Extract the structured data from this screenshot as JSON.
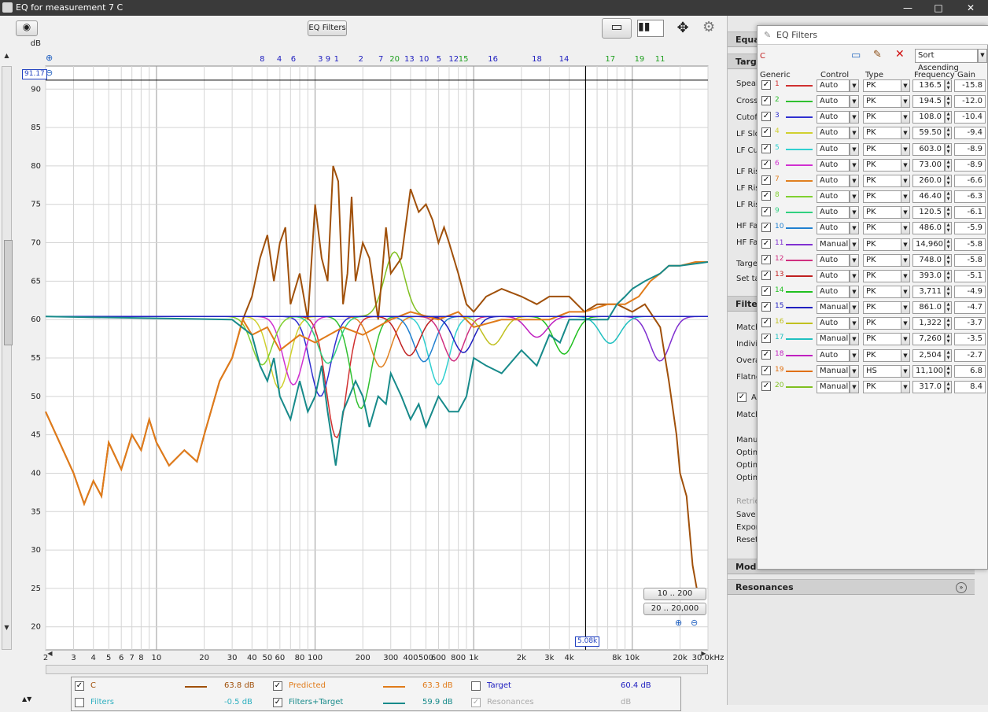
{
  "window": {
    "title": "EQ for measurement 7 C"
  },
  "toolbar": {
    "eq_filters_button": "EQ Filters"
  },
  "cursor": {
    "level": "91.17",
    "frequency": "5.08k"
  },
  "range_buttons": [
    "10 .. 200",
    "20 .. 20,000"
  ],
  "chart_data": {
    "type": "line",
    "ylabel": "dB",
    "ylim": [
      17,
      93
    ],
    "xlim": [
      2,
      30000
    ],
    "x_scale": "log",
    "y_ticks": [
      "90",
      "85",
      "80",
      "75",
      "70",
      "65",
      "60",
      "55",
      "50",
      "45",
      "40",
      "35",
      "30",
      "25",
      "20"
    ],
    "x_ticks": [
      {
        "v": 2,
        "l": "2"
      },
      {
        "v": 3,
        "l": "3"
      },
      {
        "v": 4,
        "l": "4"
      },
      {
        "v": 5,
        "l": "5"
      },
      {
        "v": 6,
        "l": "6"
      },
      {
        "v": 7,
        "l": "7"
      },
      {
        "v": 8,
        "l": "8"
      },
      {
        "v": 10,
        "l": "10"
      },
      {
        "v": 20,
        "l": "20"
      },
      {
        "v": 30,
        "l": "30"
      },
      {
        "v": 40,
        "l": "40"
      },
      {
        "v": 50,
        "l": "50"
      },
      {
        "v": 60,
        "l": "60"
      },
      {
        "v": 80,
        "l": "80"
      },
      {
        "v": 100,
        "l": "100"
      },
      {
        "v": 200,
        "l": "200"
      },
      {
        "v": 300,
        "l": "300"
      },
      {
        "v": 400,
        "l": "400"
      },
      {
        "v": 500,
        "l": "500"
      },
      {
        "v": 600,
        "l": "600"
      },
      {
        "v": 800,
        "l": "800"
      },
      {
        "v": 1000,
        "l": "1k"
      },
      {
        "v": 2000,
        "l": "2k"
      },
      {
        "v": 3000,
        "l": "3k"
      },
      {
        "v": 4000,
        "l": "4k"
      },
      {
        "v": 8000,
        "l": "8k"
      },
      {
        "v": 10000,
        "l": "10k"
      },
      {
        "v": 20000,
        "l": "20k"
      },
      {
        "v": 30000,
        "l": "30.0kHz"
      }
    ],
    "target_level": 60.4,
    "series": [
      {
        "name": "C",
        "color": "#a0500a",
        "x": [
          2,
          3,
          3.5,
          4,
          4.5,
          5,
          6,
          7,
          8,
          9,
          10,
          12,
          15,
          18,
          20,
          25,
          30,
          35,
          40,
          45,
          50,
          55,
          60,
          65,
          70,
          80,
          90,
          100,
          110,
          120,
          130,
          140,
          150,
          160,
          170,
          180,
          200,
          220,
          250,
          280,
          300,
          350,
          400,
          450,
          500,
          550,
          600,
          650,
          700,
          800,
          900,
          1000,
          1200,
          1500,
          2000,
          2500,
          3000,
          4000,
          5000,
          6000,
          8000,
          10000,
          12000,
          15000,
          17000,
          19000,
          20000,
          22000,
          24000,
          26000
        ],
        "y": [
          48,
          40,
          36,
          39,
          37,
          44,
          40.5,
          45,
          43,
          47,
          44,
          41,
          43,
          41.5,
          45,
          52,
          55,
          60,
          63,
          68,
          71,
          65,
          70,
          72,
          62,
          66,
          60,
          75,
          68,
          65,
          80,
          78,
          62,
          66,
          76,
          65,
          70,
          68,
          60,
          72,
          66,
          68,
          77,
          74,
          75,
          73,
          70,
          72,
          70,
          66,
          62,
          61,
          63,
          64,
          63,
          62,
          63,
          63,
          61,
          62,
          62,
          61,
          62,
          59,
          52,
          45,
          40,
          37,
          28,
          24
        ]
      },
      {
        "name": "Predicted",
        "color": "#e07b1a",
        "x": [
          2,
          3,
          3.5,
          4,
          4.5,
          5,
          6,
          7,
          8,
          9,
          10,
          12,
          15,
          18,
          20,
          25,
          30,
          35,
          40,
          50,
          60,
          80,
          100,
          150,
          200,
          300,
          400,
          600,
          800,
          1000,
          1500,
          2000,
          3000,
          4000,
          5000,
          7000,
          9000,
          11000,
          13000,
          15000,
          17000,
          20000,
          25000,
          30000
        ],
        "y": [
          48,
          40,
          36,
          39,
          37,
          44,
          40.5,
          45,
          43,
          47,
          44,
          41,
          43,
          41.5,
          45,
          52,
          55,
          60,
          58,
          59,
          56,
          58,
          57,
          59,
          58,
          60,
          61,
          60,
          61,
          59,
          60,
          60,
          60,
          61,
          61,
          62,
          62,
          63,
          65,
          66,
          67,
          67,
          67.5,
          67.5
        ]
      },
      {
        "name": "Target",
        "color": "#2020c0",
        "x": [
          2,
          30000
        ],
        "y": [
          60.4,
          60.4
        ]
      },
      {
        "name": "Filters+Target",
        "color": "#178a8a",
        "x": [
          2,
          30,
          40,
          45,
          50,
          55,
          60,
          70,
          80,
          90,
          100,
          110,
          120,
          135,
          150,
          180,
          200,
          220,
          250,
          280,
          300,
          350,
          400,
          450,
          500,
          600,
          700,
          800,
          900,
          1000,
          1200,
          1500,
          2000,
          2500,
          3000,
          3500,
          4000,
          5000,
          7000,
          8000,
          9000,
          10000,
          12000,
          15000,
          17000,
          20000,
          30000
        ],
        "y": [
          60.4,
          60,
          58,
          54,
          52,
          55,
          50,
          47,
          52,
          48,
          50,
          54,
          48,
          41,
          48,
          52,
          50,
          46,
          50,
          49,
          53,
          50,
          47,
          49,
          46,
          50,
          48,
          48,
          50,
          55,
          54,
          53,
          56,
          54,
          58,
          57,
          60,
          60,
          60,
          62,
          63,
          64,
          65,
          66,
          67,
          67,
          67.5
        ]
      }
    ],
    "filter_curves": [
      {
        "f": 136.5,
        "g": -15.8,
        "color": "#d03030"
      },
      {
        "f": 194.5,
        "g": -12.0,
        "color": "#30c030"
      },
      {
        "f": 108.0,
        "g": -10.4,
        "color": "#3030d0"
      },
      {
        "f": 59.5,
        "g": -9.4,
        "color": "#d0d030"
      },
      {
        "f": 603.0,
        "g": -8.9,
        "color": "#30d0d0"
      },
      {
        "f": 73.0,
        "g": -8.9,
        "color": "#d030d0"
      },
      {
        "f": 260.0,
        "g": -6.6,
        "color": "#e08020"
      },
      {
        "f": 46.4,
        "g": -6.3,
        "color": "#80d030"
      },
      {
        "f": 120.5,
        "g": -6.1,
        "color": "#30d080"
      },
      {
        "f": 486.0,
        "g": -5.9,
        "color": "#2080d0"
      },
      {
        "f": 14960,
        "g": -5.8,
        "color": "#8030d0"
      },
      {
        "f": 748.0,
        "g": -5.8,
        "color": "#d03080"
      },
      {
        "f": 393.0,
        "g": -5.1,
        "color": "#c02020"
      },
      {
        "f": 3711,
        "g": -4.9,
        "color": "#20c020"
      },
      {
        "f": 861.0,
        "g": -4.7,
        "color": "#2020c0"
      },
      {
        "f": 1322,
        "g": -3.7,
        "color": "#c0c020"
      },
      {
        "f": 7260,
        "g": -3.5,
        "color": "#20c0c0"
      },
      {
        "f": 2504,
        "g": -2.7,
        "color": "#c020c0"
      },
      {
        "f": 317.0,
        "g": 8.4,
        "color": "#80c020"
      }
    ],
    "markers": [
      {
        "label": "8",
        "f": 46.4,
        "c": "#2020c0"
      },
      {
        "label": "4",
        "f": 59.5,
        "c": "#2020c0"
      },
      {
        "label": "6",
        "f": 73.0,
        "c": "#2020c0"
      },
      {
        "label": "3",
        "f": 108,
        "c": "#2020c0"
      },
      {
        "label": "9",
        "f": 120.5,
        "c": "#2020c0"
      },
      {
        "label": "1",
        "f": 136.5,
        "c": "#2020c0"
      },
      {
        "label": "2",
        "f": 194.5,
        "c": "#2020c0"
      },
      {
        "label": "7",
        "f": 260,
        "c": "#2020c0"
      },
      {
        "label": "20",
        "f": 317,
        "c": "#20a020"
      },
      {
        "label": "13",
        "f": 393,
        "c": "#2020c0"
      },
      {
        "label": "10",
        "f": 486,
        "c": "#2020c0"
      },
      {
        "label": "5",
        "f": 603,
        "c": "#2020c0"
      },
      {
        "label": "12",
        "f": 748,
        "c": "#2020c0"
      },
      {
        "label": "15",
        "f": 861,
        "c": "#20a020"
      },
      {
        "label": "16",
        "f": 1322,
        "c": "#2020c0"
      },
      {
        "label": "18",
        "f": 2504,
        "c": "#2020c0"
      },
      {
        "label": "14",
        "f": 3711,
        "c": "#2020c0"
      },
      {
        "label": "17",
        "f": 7260,
        "c": "#20a020"
      },
      {
        "label": "19",
        "f": 11100,
        "c": "#20a020"
      },
      {
        "label": "11",
        "f": 14960,
        "c": "#20a020"
      }
    ]
  },
  "legend": {
    "row1": [
      {
        "label": "C",
        "value": "63.8 dB",
        "checked": true,
        "color": "#a0500a"
      },
      {
        "label": "Predicted",
        "value": "63.3 dB",
        "checked": true,
        "color": "#e07b1a"
      },
      {
        "label": "Target",
        "value": "60.4 dB",
        "checked": false,
        "color": "#2020c0"
      }
    ],
    "row2": [
      {
        "label": "Filters",
        "value": "-0.5 dB",
        "checked": false,
        "color": "#30b0c0"
      },
      {
        "label": "Filters+Target",
        "value": "59.9 dB",
        "checked": true,
        "color": "#178a8a"
      },
      {
        "label": "Resonances",
        "value": "dB",
        "checked": true,
        "color": "#aaaaaa"
      }
    ]
  },
  "side_panel": {
    "headers": [
      "Equaliz",
      "Target",
      "Filter",
      "Modal",
      "Resonances"
    ],
    "labels": [
      "Speake",
      "Crosso",
      "Cutoff",
      "LF Slo",
      "LF Cut",
      "LF Rise",
      "LF Rise",
      "LF Rise",
      "HF Fall",
      "HF Fall",
      "Target",
      "Set tar",
      "Match",
      "Individ",
      "Overal",
      "Flatnes",
      "Al",
      "Match",
      "Manua",
      "Optimi",
      "Optimi",
      "Optimi",
      "Retrie",
      "Save f",
      "Export",
      "Reset"
    ]
  },
  "eq_window": {
    "title": "EQ Filters",
    "channel": "C",
    "sort": "Sort Ascending",
    "columns": [
      "Generic",
      "Control",
      "Type",
      "Frequency",
      "Gain"
    ],
    "filters": [
      {
        "n": "1",
        "color": "#d03030",
        "control": "Auto",
        "type": "PK",
        "freq": "136.5",
        "gain": "-15.8"
      },
      {
        "n": "2",
        "color": "#30c030",
        "control": "Auto",
        "type": "PK",
        "freq": "194.5",
        "gain": "-12.0"
      },
      {
        "n": "3",
        "color": "#3030d0",
        "control": "Auto",
        "type": "PK",
        "freq": "108.0",
        "gain": "-10.4"
      },
      {
        "n": "4",
        "color": "#d0d030",
        "control": "Auto",
        "type": "PK",
        "freq": "59.50",
        "gain": "-9.4"
      },
      {
        "n": "5",
        "color": "#30d0d0",
        "control": "Auto",
        "type": "PK",
        "freq": "603.0",
        "gain": "-8.9"
      },
      {
        "n": "6",
        "color": "#d030d0",
        "control": "Auto",
        "type": "PK",
        "freq": "73.00",
        "gain": "-8.9"
      },
      {
        "n": "7",
        "color": "#e08020",
        "control": "Auto",
        "type": "PK",
        "freq": "260.0",
        "gain": "-6.6"
      },
      {
        "n": "8",
        "color": "#80d030",
        "control": "Auto",
        "type": "PK",
        "freq": "46.40",
        "gain": "-6.3"
      },
      {
        "n": "9",
        "color": "#30d080",
        "control": "Auto",
        "type": "PK",
        "freq": "120.5",
        "gain": "-6.1"
      },
      {
        "n": "10",
        "color": "#2080d0",
        "control": "Auto",
        "type": "PK",
        "freq": "486.0",
        "gain": "-5.9"
      },
      {
        "n": "11",
        "color": "#8030d0",
        "control": "Manual",
        "type": "PK",
        "freq": "14,960",
        "gain": "-5.8"
      },
      {
        "n": "12",
        "color": "#d03080",
        "control": "Auto",
        "type": "PK",
        "freq": "748.0",
        "gain": "-5.8"
      },
      {
        "n": "13",
        "color": "#c02020",
        "control": "Auto",
        "type": "PK",
        "freq": "393.0",
        "gain": "-5.1"
      },
      {
        "n": "14",
        "color": "#20c020",
        "control": "Auto",
        "type": "PK",
        "freq": "3,711",
        "gain": "-4.9"
      },
      {
        "n": "15",
        "color": "#2020c0",
        "control": "Manual",
        "type": "PK",
        "freq": "861.0",
        "gain": "-4.7"
      },
      {
        "n": "16",
        "color": "#c0c020",
        "control": "Auto",
        "type": "PK",
        "freq": "1,322",
        "gain": "-3.7"
      },
      {
        "n": "17",
        "color": "#20c0c0",
        "control": "Manual",
        "type": "PK",
        "freq": "7,260",
        "gain": "-3.5"
      },
      {
        "n": "18",
        "color": "#c020c0",
        "control": "Auto",
        "type": "PK",
        "freq": "2,504",
        "gain": "-2.7"
      },
      {
        "n": "19",
        "color": "#e07010",
        "control": "Manual",
        "type": "HS",
        "freq": "11,100",
        "gain": "6.8"
      },
      {
        "n": "20",
        "color": "#80c020",
        "control": "Manual",
        "type": "PK",
        "freq": "317.0",
        "gain": "8.4"
      }
    ]
  }
}
